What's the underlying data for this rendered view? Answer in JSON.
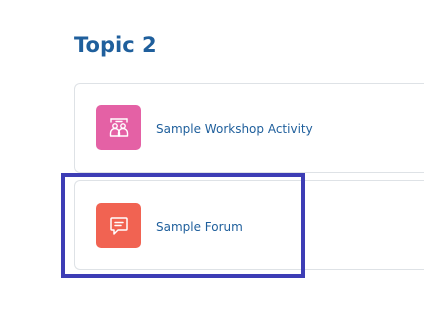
{
  "section": {
    "title": "Topic 2"
  },
  "activities": [
    {
      "name": "Sample Workshop Activity",
      "icon": "workshop-icon",
      "icon_color": "#e461a5"
    },
    {
      "name": "Sample Forum",
      "icon": "forum-icon",
      "icon_color": "#f16352"
    }
  ],
  "highlight": {
    "color": "#3d3db5",
    "target": "Sample Forum"
  }
}
